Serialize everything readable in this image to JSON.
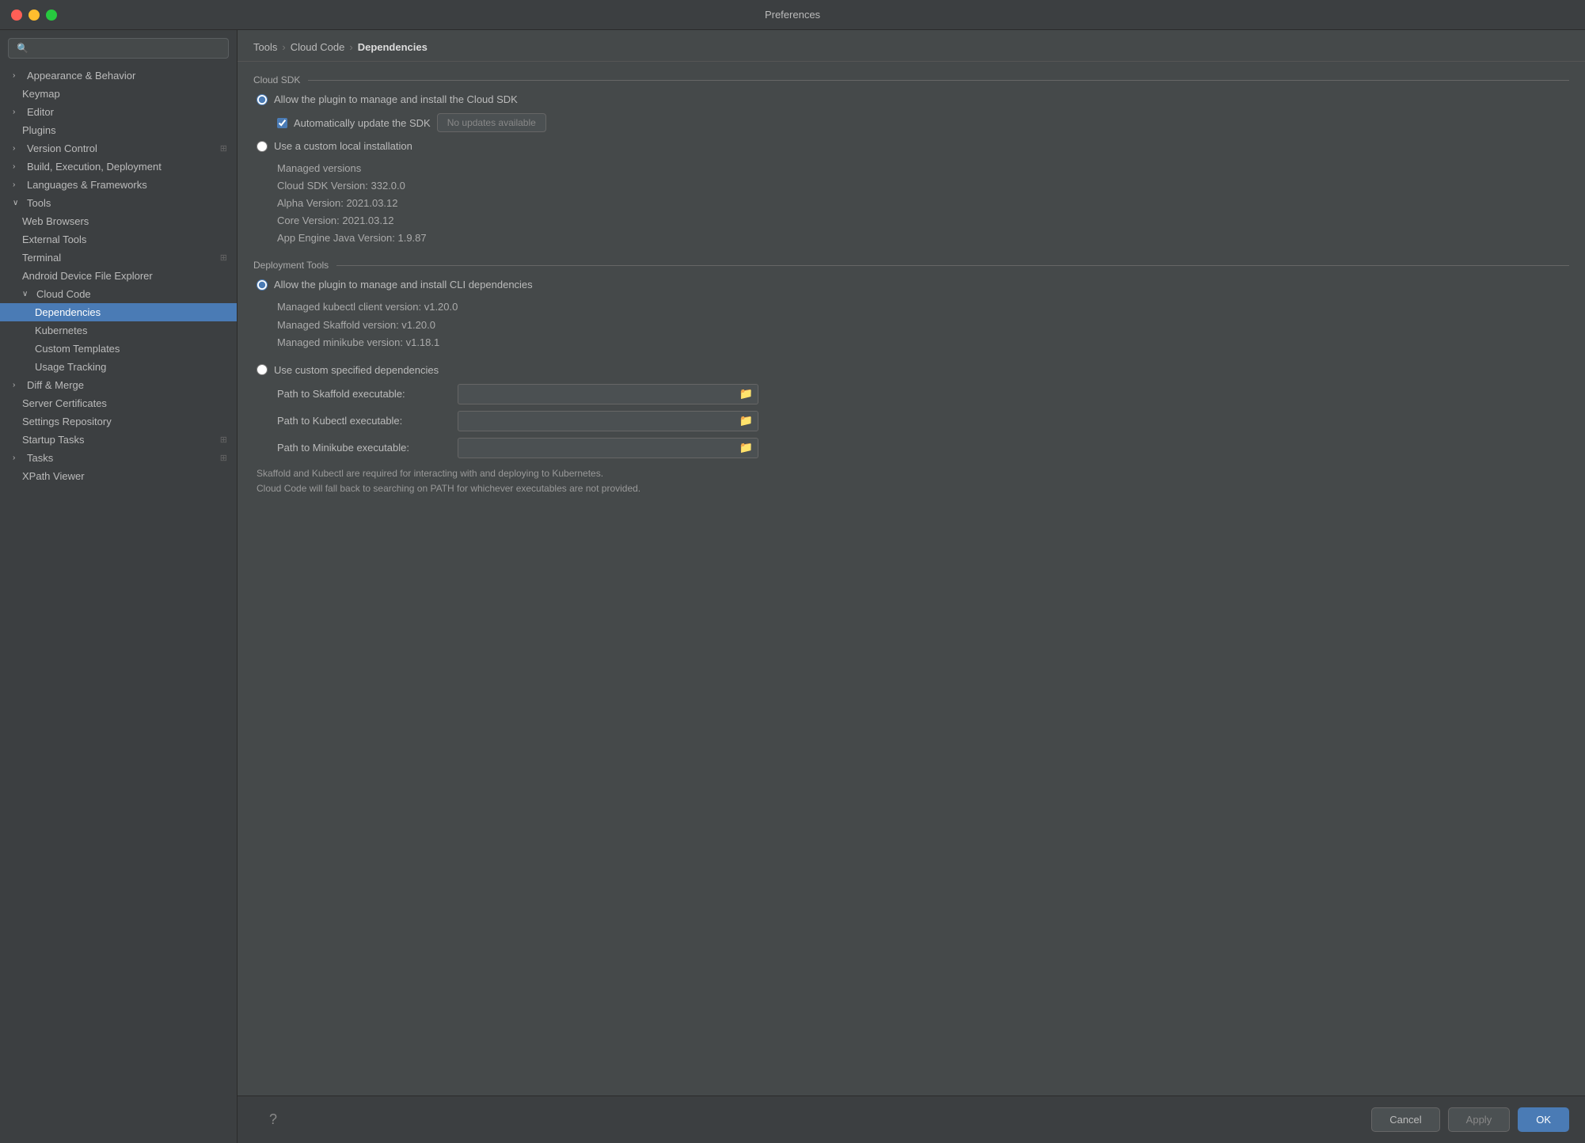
{
  "window": {
    "title": "Preferences"
  },
  "sidebar": {
    "search_placeholder": "🔍",
    "items": [
      {
        "id": "appearance",
        "label": "Appearance & Behavior",
        "level": 0,
        "hasChevron": true,
        "chevron": "›",
        "collapsed": true
      },
      {
        "id": "keymap",
        "label": "Keymap",
        "level": 0,
        "hasChevron": false
      },
      {
        "id": "editor",
        "label": "Editor",
        "level": 0,
        "hasChevron": true,
        "chevron": "›",
        "collapsed": true
      },
      {
        "id": "plugins",
        "label": "Plugins",
        "level": 0,
        "hasChevron": false
      },
      {
        "id": "version-control",
        "label": "Version Control",
        "level": 0,
        "hasChevron": true,
        "chevron": "›",
        "collapsed": true,
        "hasIcon": true
      },
      {
        "id": "build",
        "label": "Build, Execution, Deployment",
        "level": 0,
        "hasChevron": true,
        "chevron": "›",
        "collapsed": true
      },
      {
        "id": "languages",
        "label": "Languages & Frameworks",
        "level": 0,
        "hasChevron": true,
        "chevron": "›",
        "collapsed": true
      },
      {
        "id": "tools",
        "label": "Tools",
        "level": 0,
        "hasChevron": true,
        "chevron": "∨",
        "collapsed": false
      },
      {
        "id": "web-browsers",
        "label": "Web Browsers",
        "level": 1
      },
      {
        "id": "external-tools",
        "label": "External Tools",
        "level": 1
      },
      {
        "id": "terminal",
        "label": "Terminal",
        "level": 1,
        "hasIcon": true
      },
      {
        "id": "android-device",
        "label": "Android Device File Explorer",
        "level": 1
      },
      {
        "id": "cloud-code",
        "label": "Cloud Code",
        "level": 1,
        "hasChevron": true,
        "chevron": "∨",
        "collapsed": false
      },
      {
        "id": "dependencies",
        "label": "Dependencies",
        "level": 2,
        "active": true
      },
      {
        "id": "kubernetes",
        "label": "Kubernetes",
        "level": 2
      },
      {
        "id": "custom-templates",
        "label": "Custom Templates",
        "level": 2
      },
      {
        "id": "usage-tracking",
        "label": "Usage Tracking",
        "level": 2
      },
      {
        "id": "diff-merge",
        "label": "Diff & Merge",
        "level": 0,
        "hasChevron": true,
        "chevron": "›",
        "collapsed": true
      },
      {
        "id": "server-certificates",
        "label": "Server Certificates",
        "level": 1
      },
      {
        "id": "settings-repository",
        "label": "Settings Repository",
        "level": 1
      },
      {
        "id": "startup-tasks",
        "label": "Startup Tasks",
        "level": 1,
        "hasIcon": true
      },
      {
        "id": "tasks",
        "label": "Tasks",
        "level": 0,
        "hasChevron": true,
        "chevron": "›",
        "collapsed": true,
        "hasIcon": true
      },
      {
        "id": "xpath-viewer",
        "label": "XPath Viewer",
        "level": 1
      }
    ]
  },
  "breadcrumb": {
    "parts": [
      "Tools",
      "Cloud Code",
      "Dependencies"
    ]
  },
  "content": {
    "cloud_sdk_section": "Cloud SDK",
    "radio1_label": "Allow the plugin to manage and install the Cloud SDK",
    "checkbox1_label": "Automatically update the SDK",
    "no_updates_label": "No updates available",
    "radio2_label": "Use a custom local installation",
    "managed_versions_label": "Managed versions",
    "cloud_sdk_version": "Cloud SDK Version: 332.0.0",
    "alpha_version": "Alpha Version: 2021.03.12",
    "core_version": "Core Version: 2021.03.12",
    "app_engine_version": "App Engine Java Version: 1.9.87",
    "deployment_tools_section": "Deployment Tools",
    "radio3_label": "Allow the plugin to manage and install CLI dependencies",
    "managed_kubectl": "Managed kubectl client version: v1.20.0",
    "managed_skaffold": "Managed Skaffold version: v1.20.0",
    "managed_minikube": "Managed minikube version: v1.18.1",
    "radio4_label": "Use custom specified dependencies",
    "path_skaffold_label": "Path to Skaffold executable:",
    "path_kubectl_label": "Path to Kubectl executable:",
    "path_minikube_label": "Path to Minikube executable:",
    "footer_note_line1": "Skaffold and Kubectl are required for interacting with and deploying to Kubernetes.",
    "footer_note_line2": "Cloud Code will fall back to searching on PATH for whichever executables are not provided."
  },
  "footer": {
    "cancel_label": "Cancel",
    "apply_label": "Apply",
    "ok_label": "OK"
  }
}
